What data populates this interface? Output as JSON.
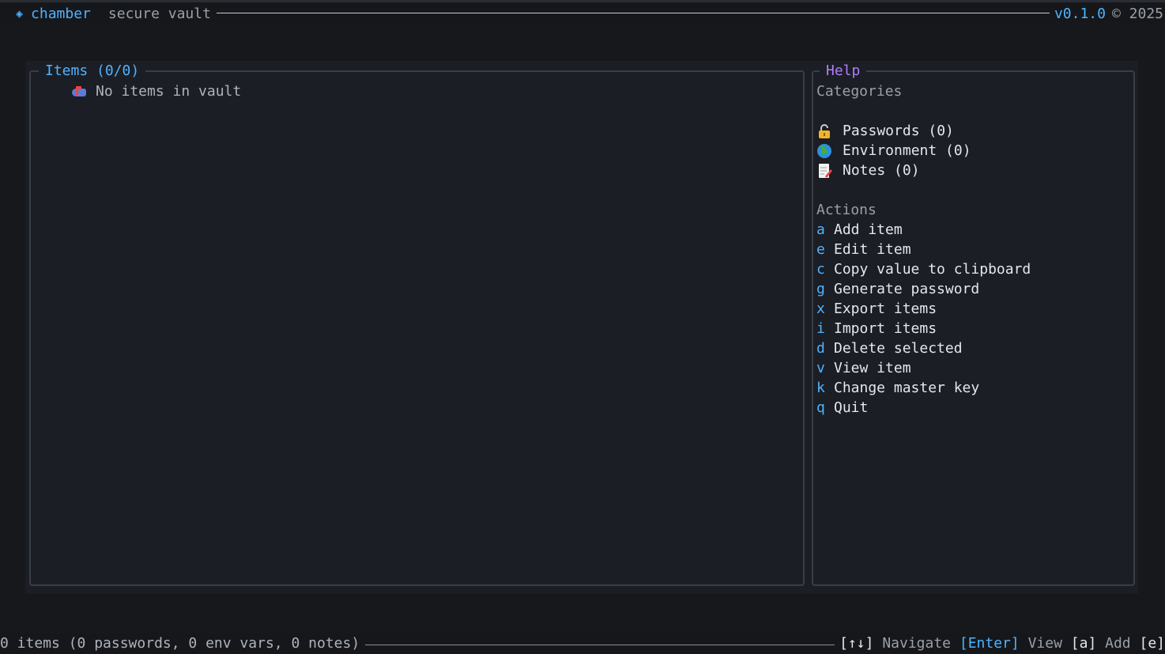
{
  "topbar": {
    "app_name": "chamber",
    "subtitle": "secure vault",
    "version": "v0.1.0",
    "copyright": "© 2025"
  },
  "items_panel": {
    "title": "Items (0/0)",
    "empty_message": "No items in vault"
  },
  "help_panel": {
    "title": "Help",
    "categories_heading": "Categories",
    "categories": [
      {
        "label": "Passwords (0)",
        "icon": "lock-icon"
      },
      {
        "label": "Environment (0)",
        "icon": "globe-icon"
      },
      {
        "label": "Notes (0)",
        "icon": "memo-icon"
      }
    ],
    "actions_heading": "Actions",
    "actions": [
      {
        "key": "a",
        "label": "Add item"
      },
      {
        "key": "e",
        "label": "Edit item"
      },
      {
        "key": "c",
        "label": "Copy value to clipboard"
      },
      {
        "key": "g",
        "label": "Generate password"
      },
      {
        "key": "x",
        "label": "Export items"
      },
      {
        "key": "i",
        "label": "Import items"
      },
      {
        "key": "d",
        "label": "Delete selected"
      },
      {
        "key": "v",
        "label": "View item"
      },
      {
        "key": "k",
        "label": "Change master key"
      },
      {
        "key": "q",
        "label": "Quit"
      }
    ]
  },
  "statusbar": {
    "summary": "0 items (0 passwords, 0 env vars, 0 notes)",
    "shortcuts": [
      {
        "key": "[↑↓]",
        "label": "Navigate"
      },
      {
        "key": "[Enter]",
        "label": "View"
      },
      {
        "key": "[a]",
        "label": "Add"
      },
      {
        "key": "[e]",
        "label": ""
      }
    ]
  },
  "colors": {
    "accent": "#4fb3ff",
    "help_title": "#b27cff",
    "background": "#16181c"
  }
}
